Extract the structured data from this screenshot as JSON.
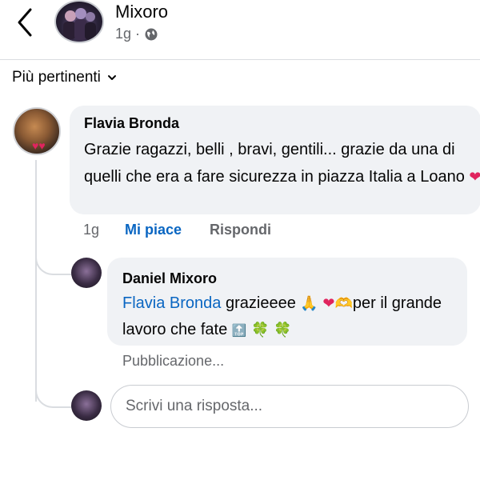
{
  "header": {
    "title": "Mixoro",
    "time": "1g",
    "separator": "·",
    "privacy_icon": "globe-icon"
  },
  "sort": {
    "label": "Più pertinenti",
    "icon": "chevron-down-icon"
  },
  "comment": {
    "author": "Flavia Bronda",
    "text": "Grazie ragazzi, belli , bravi, gentili... grazie da una di quelli che era a fare sicurezza in piazza Italia a Loano",
    "heart": "❤",
    "time": "1g",
    "like_label": "Mi piace",
    "reply_label": "Rispondi"
  },
  "reply": {
    "author": "Daniel Mixoro",
    "mention": "Flavia Bronda",
    "text_a": "grazieeee",
    "pray": "🙏",
    "heart": "❤",
    "hands": "🫶",
    "text_b": "per il grande lavoro che fate",
    "top": "🔝",
    "clovers": "🍀 🍀",
    "status": "Pubblicazione..."
  },
  "reply_box": {
    "placeholder": "Scrivi una risposta..."
  },
  "colors": {
    "accent": "#0a66c2",
    "bubble": "#f0f2f5",
    "muted": "#65676b"
  }
}
